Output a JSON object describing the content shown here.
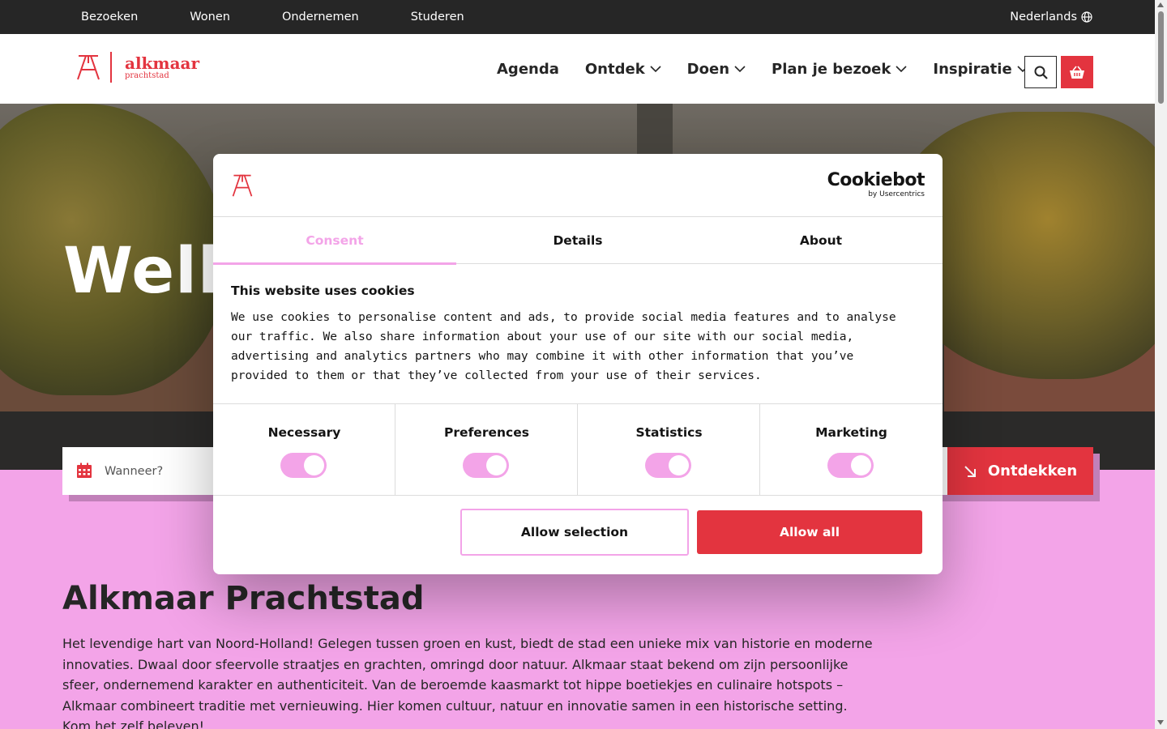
{
  "topbar": {
    "links": [
      "Bezoeken",
      "Wonen",
      "Ondernemen",
      "Studeren"
    ],
    "language": "Nederlands"
  },
  "header": {
    "logo": {
      "name": "alkmaar",
      "tagline": "prachtstad"
    },
    "nav": [
      {
        "label": "Agenda",
        "dropdown": false
      },
      {
        "label": "Ontdek",
        "dropdown": true
      },
      {
        "label": "Doen",
        "dropdown": true
      },
      {
        "label": "Plan je bezoek",
        "dropdown": true
      },
      {
        "label": "Inspiratie",
        "dropdown": true
      }
    ],
    "search_icon": "search-icon",
    "basket_icon": "basket-icon"
  },
  "hero": {
    "heading_visible": "Welk"
  },
  "searchbar": {
    "placeholder": "Wanneer?",
    "button_label": "Ontdekken",
    "button_icon": "arrow-down-right-icon"
  },
  "content": {
    "title": "Alkmaar Prachtstad",
    "body": "Het levendige hart van Noord-Holland! Gelegen tussen groen en kust, biedt de stad een unieke mix van historie en moderne innovaties. Dwaal door sfeervolle straatjes en grachten, omringd door natuur. Alkmaar staat bekend om zijn persoonlijke sfeer, ondernemend karakter en authenticiteit. Van de beroemde kaasmarkt tot hippe boetiekjes en culinaire hotspots – Alkmaar combineert traditie met vernieuwing. Hier komen cultuur, natuur en innovatie samen in een historische setting. Kom het zelf beleven!"
  },
  "cookie_dialog": {
    "brand": {
      "name": "Cookiebot",
      "sub": "by Usercentrics"
    },
    "tabs": [
      {
        "label": "Consent",
        "active": true
      },
      {
        "label": "Details",
        "active": false
      },
      {
        "label": "About",
        "active": false
      }
    ],
    "title": "This website uses cookies",
    "text": "We use cookies to personalise content and ads, to provide social media features and to analyse our traffic. We also share information about your use of our site with our social media, advertising and analytics partners who may combine it with other information that you’ve provided to them or that they’ve collected from your use of their services.",
    "categories": [
      {
        "label": "Necessary",
        "enabled": true
      },
      {
        "label": "Preferences",
        "enabled": true
      },
      {
        "label": "Statistics",
        "enabled": true
      },
      {
        "label": "Marketing",
        "enabled": true
      }
    ],
    "buttons": {
      "selection": "Allow selection",
      "all": "Allow all"
    }
  },
  "colors": {
    "brand_red": "#e3343f",
    "accent_pink": "#f3a4e8",
    "dark": "#262626"
  }
}
